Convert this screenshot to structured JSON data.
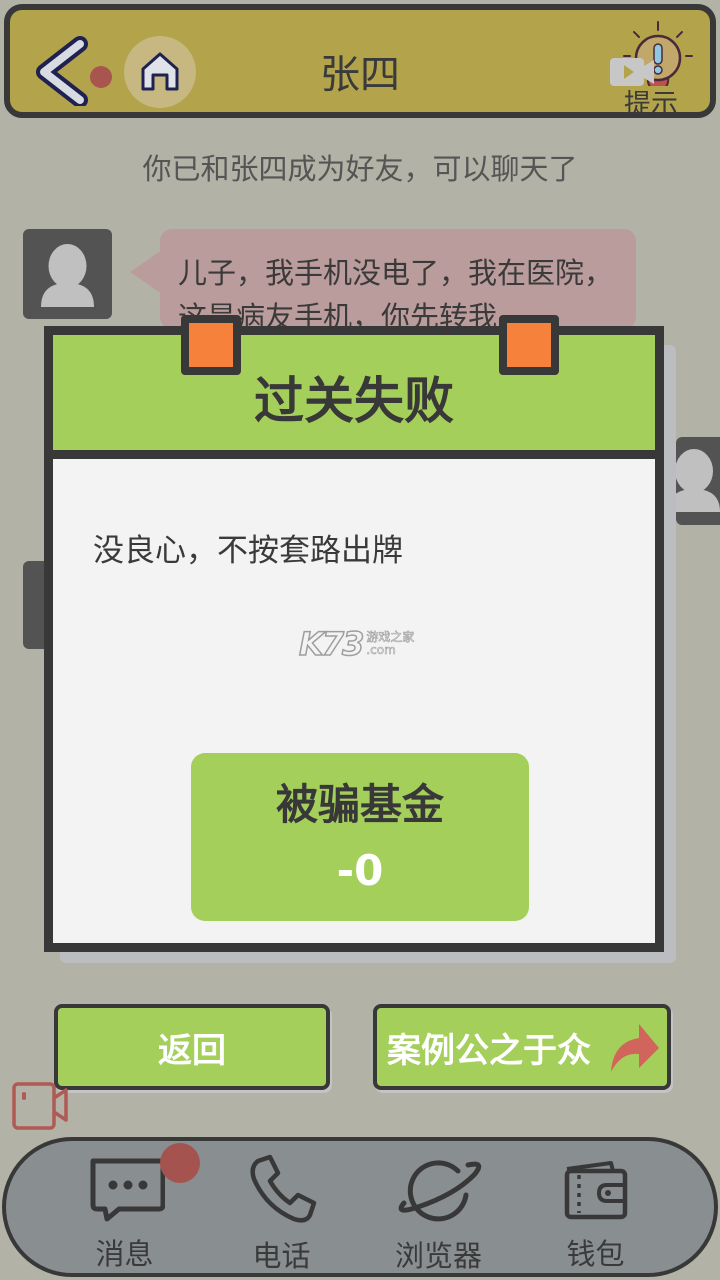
{
  "header": {
    "title": "张四",
    "back_icon": "chevron-left-icon",
    "home_icon": "home-icon",
    "hint_label": "提示",
    "hint_icon": "lightbulb-icon",
    "hint_video_icon": "video-play-icon"
  },
  "chat": {
    "system_note": "你已和张四成为好友，可以聊天了",
    "messages": [
      {
        "sender": "张四",
        "text": "儿子，我手机没电了，我在医院，这是病友手机，你先转我"
      }
    ]
  },
  "result_dialog": {
    "title": "过关失败",
    "message": "没良心，不按套路出牌",
    "fund_label": "被骗基金",
    "fund_value": "-0",
    "watermark_logo": "K73",
    "watermark_text": "游戏之家",
    "watermark_domain": ".com"
  },
  "actions": {
    "back_label": "返回",
    "share_label": "案例公之于众",
    "share_icon": "share-arrow-icon",
    "record_icon": "video-camera-icon"
  },
  "bottom_nav": {
    "items": [
      {
        "label": "消息",
        "icon": "message-icon",
        "has_badge": true
      },
      {
        "label": "电话",
        "icon": "phone-icon",
        "has_badge": false
      },
      {
        "label": "浏览器",
        "icon": "planet-icon",
        "has_badge": false
      },
      {
        "label": "钱包",
        "icon": "wallet-icon",
        "has_badge": false
      }
    ]
  },
  "colors": {
    "background": "#b3b2a6",
    "header": "#b3a44c",
    "accent_green": "#a5cf5b",
    "pin_orange": "#f6813a",
    "bubble": "#bb9c9c",
    "badge_red": "#a5534f",
    "nav_bar": "#898e91"
  }
}
